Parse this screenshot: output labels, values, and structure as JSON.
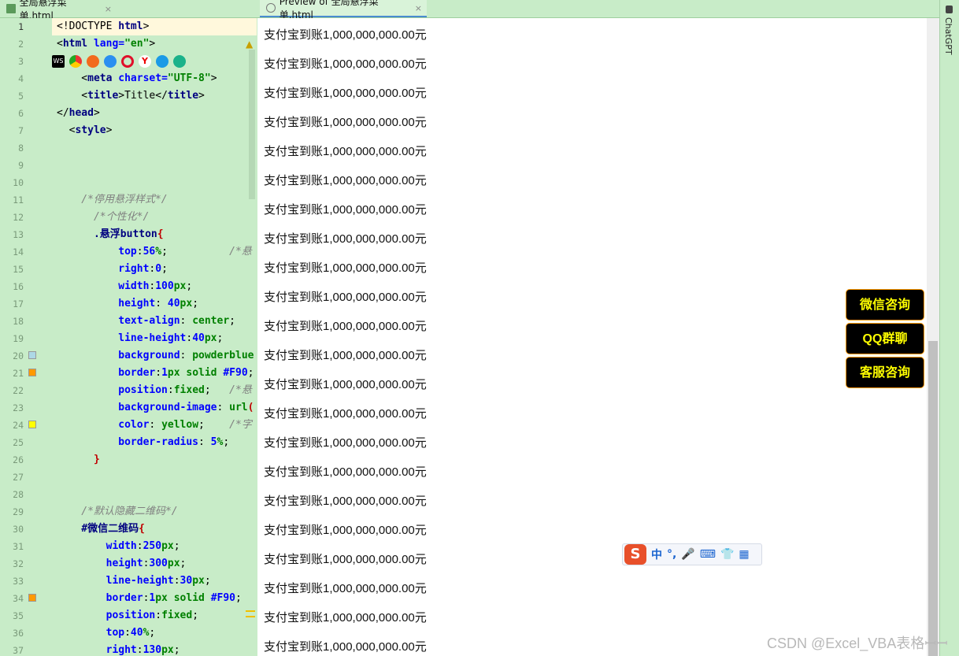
{
  "tabs": [
    {
      "label": "全局悬浮菜单.html",
      "close": "×"
    },
    {
      "label": "Preview of 全局悬浮菜单.html",
      "close": "×"
    }
  ],
  "side_panel": {
    "label": "ChatGPT"
  },
  "editor": {
    "line_numbers": [
      "1",
      "2",
      "3",
      "4",
      "5",
      "6",
      "7",
      "8",
      "9",
      "10",
      "11",
      "12",
      "13",
      "14",
      "15",
      "16",
      "17",
      "18",
      "19",
      "20",
      "21",
      "22",
      "23",
      "24",
      "25",
      "26",
      "27",
      "28",
      "29",
      "30",
      "31",
      "32",
      "33",
      "34",
      "35",
      "36",
      "37"
    ],
    "lines": [
      [
        [
          "t-pl",
          "<!DOCTYPE "
        ],
        [
          "t-tag",
          "html"
        ],
        [
          "t-pl",
          ">"
        ]
      ],
      [
        [
          "t-pl",
          "<"
        ],
        [
          "t-tag",
          "html "
        ],
        [
          "t-attr",
          "lang="
        ],
        [
          "t-str",
          "\"en\""
        ],
        [
          "t-pl",
          ">"
        ]
      ],
      [
        [
          "t-pl",
          "  <"
        ],
        [
          "t-tag",
          "head"
        ],
        [
          "t-pl",
          ">"
        ]
      ],
      [
        [
          "t-pl",
          "    <"
        ],
        [
          "t-tag",
          "meta "
        ],
        [
          "t-attr",
          "charset="
        ],
        [
          "t-str",
          "\"UTF-8\""
        ],
        [
          "t-pl",
          ">"
        ]
      ],
      [
        [
          "t-pl",
          "    <"
        ],
        [
          "t-tag",
          "title"
        ],
        [
          "t-pl",
          ">Title</"
        ],
        [
          "t-tag",
          "title"
        ],
        [
          "t-pl",
          ">"
        ]
      ],
      [
        [
          "t-pl",
          "</"
        ],
        [
          "t-tag",
          "head"
        ],
        [
          "t-pl",
          ">"
        ]
      ],
      [
        [
          "t-pl",
          "  <"
        ],
        [
          "t-tag",
          "style"
        ],
        [
          "t-pl",
          ">"
        ]
      ],
      [],
      [],
      [],
      [
        [
          "t-cm",
          "    /*停用悬浮样式*/"
        ]
      ],
      [
        [
          "t-cm",
          "      /*个性化*/"
        ]
      ],
      [
        [
          "t-sel",
          "      .悬浮button"
        ],
        [
          "t-br",
          "{"
        ]
      ],
      [
        [
          "t-prop",
          "          top"
        ],
        [
          "t-pl",
          ":"
        ],
        [
          "t-num",
          "56"
        ],
        [
          "t-kw",
          "%"
        ],
        [
          "t-pl",
          ";          "
        ],
        [
          "t-cm",
          "/*悬"
        ]
      ],
      [
        [
          "t-prop",
          "          right"
        ],
        [
          "t-pl",
          ":"
        ],
        [
          "t-num",
          "0"
        ],
        [
          "t-pl",
          ";"
        ]
      ],
      [
        [
          "t-prop",
          "          width"
        ],
        [
          "t-pl",
          ":"
        ],
        [
          "t-num",
          "100"
        ],
        [
          "t-kw",
          "px"
        ],
        [
          "t-pl",
          ";"
        ]
      ],
      [
        [
          "t-prop",
          "          height"
        ],
        [
          "t-pl",
          ": "
        ],
        [
          "t-num",
          "40"
        ],
        [
          "t-kw",
          "px"
        ],
        [
          "t-pl",
          ";"
        ]
      ],
      [
        [
          "t-prop",
          "          text-align"
        ],
        [
          "t-pl",
          ": "
        ],
        [
          "t-kw",
          "center"
        ],
        [
          "t-pl",
          ";"
        ]
      ],
      [
        [
          "t-prop",
          "          line-height"
        ],
        [
          "t-pl",
          ":"
        ],
        [
          "t-num",
          "40"
        ],
        [
          "t-kw",
          "px"
        ],
        [
          "t-pl",
          ";"
        ]
      ],
      [
        [
          "t-prop",
          "          background"
        ],
        [
          "t-pl",
          ": "
        ],
        [
          "t-kw",
          "powderblue"
        ]
      ],
      [
        [
          "t-prop",
          "          border"
        ],
        [
          "t-pl",
          ":"
        ],
        [
          "t-num",
          "1"
        ],
        [
          "t-kw",
          "px solid "
        ],
        [
          "t-num",
          "#F90"
        ],
        [
          "t-pl",
          ";"
        ]
      ],
      [
        [
          "t-prop",
          "          position"
        ],
        [
          "t-pl",
          ":"
        ],
        [
          "t-kw",
          "fixed"
        ],
        [
          "t-pl",
          ";   "
        ],
        [
          "t-cm",
          "/*悬"
        ]
      ],
      [
        [
          "t-prop",
          "          background-image"
        ],
        [
          "t-pl",
          ": "
        ],
        [
          "t-kw",
          "url"
        ],
        [
          "t-br",
          "("
        ]
      ],
      [
        [
          "t-prop",
          "          color"
        ],
        [
          "t-pl",
          ": "
        ],
        [
          "t-kw",
          "yellow"
        ],
        [
          "t-pl",
          ";    "
        ],
        [
          "t-cm",
          "/*字"
        ]
      ],
      [
        [
          "t-prop",
          "          border-radius"
        ],
        [
          "t-pl",
          ": "
        ],
        [
          "t-num",
          "5"
        ],
        [
          "t-kw",
          "%"
        ],
        [
          "t-pl",
          ";"
        ]
      ],
      [
        [
          "t-br",
          "      }"
        ]
      ],
      [],
      [],
      [
        [
          "t-cm",
          "    /*默认隐藏二维码*/"
        ]
      ],
      [
        [
          "t-sel",
          "    #微信二维码"
        ],
        [
          "t-br",
          "{"
        ]
      ],
      [
        [
          "t-prop",
          "        width"
        ],
        [
          "t-pl",
          ":"
        ],
        [
          "t-num",
          "250"
        ],
        [
          "t-kw",
          "px"
        ],
        [
          "t-pl",
          ";"
        ]
      ],
      [
        [
          "t-prop",
          "        height"
        ],
        [
          "t-pl",
          ":"
        ],
        [
          "t-num",
          "300"
        ],
        [
          "t-kw",
          "px"
        ],
        [
          "t-pl",
          ";"
        ]
      ],
      [
        [
          "t-prop",
          "        line-height"
        ],
        [
          "t-pl",
          ":"
        ],
        [
          "t-num",
          "30"
        ],
        [
          "t-kw",
          "px"
        ],
        [
          "t-pl",
          ";"
        ]
      ],
      [
        [
          "t-prop",
          "        border"
        ],
        [
          "t-pl",
          ":"
        ],
        [
          "t-num",
          "1"
        ],
        [
          "t-kw",
          "px solid "
        ],
        [
          "t-num",
          "#F90"
        ],
        [
          "t-pl",
          ";"
        ]
      ],
      [
        [
          "t-prop",
          "        position"
        ],
        [
          "t-pl",
          ":"
        ],
        [
          "t-kw",
          "fixed"
        ],
        [
          "t-pl",
          ";"
        ]
      ],
      [
        [
          "t-prop",
          "        top"
        ],
        [
          "t-pl",
          ":"
        ],
        [
          "t-num",
          "40"
        ],
        [
          "t-kw",
          "%"
        ],
        [
          "t-pl",
          ";"
        ]
      ],
      [
        [
          "t-prop",
          "        right"
        ],
        [
          "t-pl",
          ":"
        ],
        [
          "t-num",
          "130"
        ],
        [
          "t-kw",
          "px"
        ],
        [
          "t-pl",
          ";"
        ]
      ]
    ]
  },
  "preview": {
    "rows": [
      "支付宝到账1,000,000,000.00元",
      "支付宝到账1,000,000,000.00元",
      "支付宝到账1,000,000,000.00元",
      "支付宝到账1,000,000,000.00元",
      "支付宝到账1,000,000,000.00元",
      "支付宝到账1,000,000,000.00元",
      "支付宝到账1,000,000,000.00元",
      "支付宝到账1,000,000,000.00元",
      "支付宝到账1,000,000,000.00元",
      "支付宝到账1,000,000,000.00元",
      "支付宝到账1,000,000,000.00元",
      "支付宝到账1,000,000,000.00元",
      "支付宝到账1,000,000,000.00元",
      "支付宝到账1,000,000,000.00元",
      "支付宝到账1,000,000,000.00元",
      "支付宝到账1,000,000,000.00元",
      "支付宝到账1,000,000,000.00元",
      "支付宝到账1,000,000,000.00元",
      "支付宝到账1,000,000,000.00元",
      "支付宝到账1,000,000,000.00元",
      "支付宝到账1,000,000,000.00元",
      "支付宝到账1,000,000,000.00元"
    ],
    "floating_buttons": [
      "微信咨询",
      "QQ群聊",
      "客服咨询"
    ]
  },
  "ime_toolbar": {
    "logo": "S",
    "items": [
      "中",
      "°,",
      "🎤",
      "⌨",
      "👕",
      "▦"
    ]
  },
  "watermark": "CSDN @Excel_VBA表格ꟷꟷ",
  "colors": {
    "ide_bg": "#c8ecc8",
    "button_bg": "#000000",
    "button_text": "#ffff00",
    "button_border": "#ff9900"
  }
}
